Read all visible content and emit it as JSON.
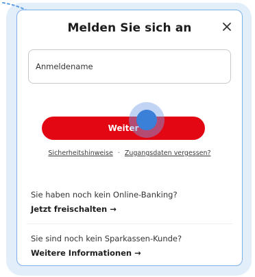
{
  "dialog": {
    "title": "Melden Sie sich an",
    "close_icon": "close-icon"
  },
  "login": {
    "username_placeholder": "Anmeldename",
    "username_value": ""
  },
  "actions": {
    "continue_label": "Weiter"
  },
  "links": {
    "security_label": "Sicherheitshinweise",
    "separator": "·",
    "forgot_label": "Zugangsdaten vergessen?"
  },
  "online_banking": {
    "question": "Sie haben noch kein Online-Banking?",
    "cta": "Jetzt freischalten →"
  },
  "customer": {
    "question": "Sie sind noch kein Sparkassen-Kunde?",
    "cta": "Weitere Informationen →"
  },
  "colors": {
    "primary_button": "#e30613",
    "dialog_border": "#7fb0ea",
    "cursor": "#3a7fd8"
  }
}
